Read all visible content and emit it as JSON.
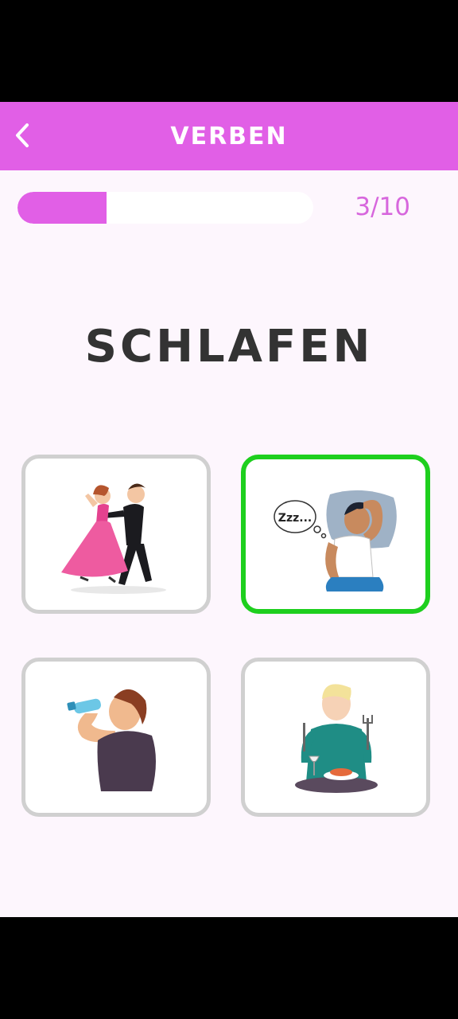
{
  "header": {
    "title": "VERBEN",
    "back_icon": "chevron-left-icon"
  },
  "progress": {
    "current": 3,
    "total": 10,
    "label": "3/10",
    "fraction": 0.3
  },
  "word": "SCHLAFEN",
  "options": [
    {
      "name": "dancing-couple",
      "selected": false
    },
    {
      "name": "sleeping-man",
      "selected": true,
      "bubble_text": "Zzz..."
    },
    {
      "name": "drinking-man",
      "selected": false
    },
    {
      "name": "eating-man",
      "selected": false
    }
  ],
  "colors": {
    "accent": "#e15fe6",
    "correct": "#1ecf1e",
    "card_border": "#d0d0d0"
  }
}
